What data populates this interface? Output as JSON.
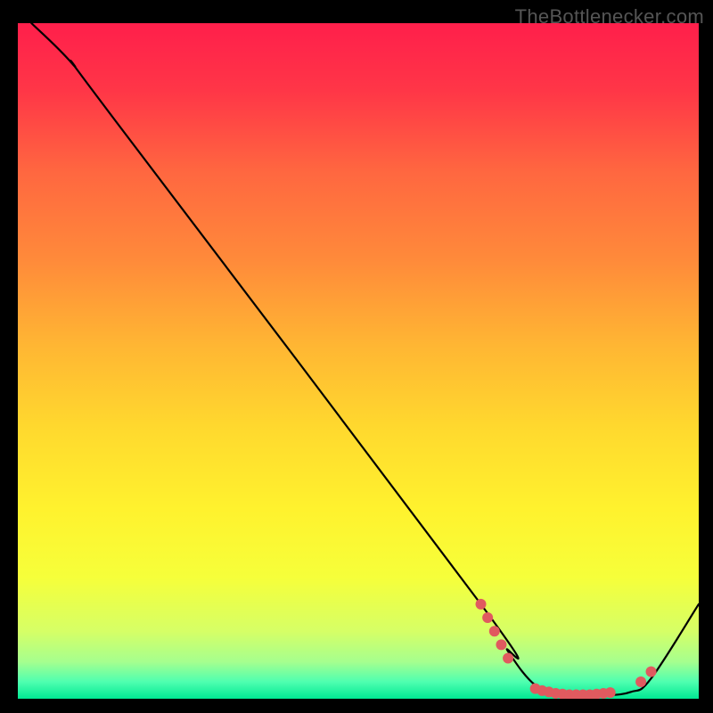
{
  "watermark": "TheBottlenecker.com",
  "chart_data": {
    "type": "line",
    "title": "",
    "xlabel": "",
    "ylabel": "",
    "x_range": [
      0,
      100
    ],
    "y_range": [
      0,
      100
    ],
    "series": [
      {
        "name": "curve",
        "color": "#000000",
        "points": [
          {
            "x": 2,
            "y": 100
          },
          {
            "x": 8,
            "y": 94
          },
          {
            "x": 14,
            "y": 86
          },
          {
            "x": 68,
            "y": 14
          },
          {
            "x": 72,
            "y": 7
          },
          {
            "x": 76,
            "y": 2
          },
          {
            "x": 80,
            "y": 0.5
          },
          {
            "x": 86,
            "y": 0.5
          },
          {
            "x": 90,
            "y": 1
          },
          {
            "x": 93,
            "y": 3
          },
          {
            "x": 100,
            "y": 14
          }
        ]
      }
    ],
    "markers": {
      "name": "highlight-dots",
      "color": "#e05a5f",
      "radius": 6,
      "points": [
        {
          "x": 68,
          "y": 14
        },
        {
          "x": 69,
          "y": 12
        },
        {
          "x": 70,
          "y": 10
        },
        {
          "x": 71,
          "y": 8
        },
        {
          "x": 72,
          "y": 6
        },
        {
          "x": 76,
          "y": 1.5
        },
        {
          "x": 77,
          "y": 1.2
        },
        {
          "x": 78,
          "y": 1.0
        },
        {
          "x": 79,
          "y": 0.8
        },
        {
          "x": 80,
          "y": 0.7
        },
        {
          "x": 81,
          "y": 0.6
        },
        {
          "x": 82,
          "y": 0.6
        },
        {
          "x": 83,
          "y": 0.6
        },
        {
          "x": 84,
          "y": 0.6
        },
        {
          "x": 85,
          "y": 0.7
        },
        {
          "x": 86,
          "y": 0.8
        },
        {
          "x": 87,
          "y": 0.9
        },
        {
          "x": 91.5,
          "y": 2.5
        },
        {
          "x": 93,
          "y": 4
        }
      ]
    },
    "background_gradient": {
      "stops": [
        {
          "offset": 0.0,
          "color": "#ff1f4b"
        },
        {
          "offset": 0.1,
          "color": "#ff3647"
        },
        {
          "offset": 0.22,
          "color": "#ff6740"
        },
        {
          "offset": 0.35,
          "color": "#ff8a3a"
        },
        {
          "offset": 0.48,
          "color": "#ffb733"
        },
        {
          "offset": 0.6,
          "color": "#ffd92e"
        },
        {
          "offset": 0.72,
          "color": "#fff22e"
        },
        {
          "offset": 0.82,
          "color": "#f6ff3a"
        },
        {
          "offset": 0.9,
          "color": "#d6ff66"
        },
        {
          "offset": 0.945,
          "color": "#a6ff8e"
        },
        {
          "offset": 0.975,
          "color": "#4fffb0"
        },
        {
          "offset": 1.0,
          "color": "#00e893"
        }
      ]
    }
  }
}
